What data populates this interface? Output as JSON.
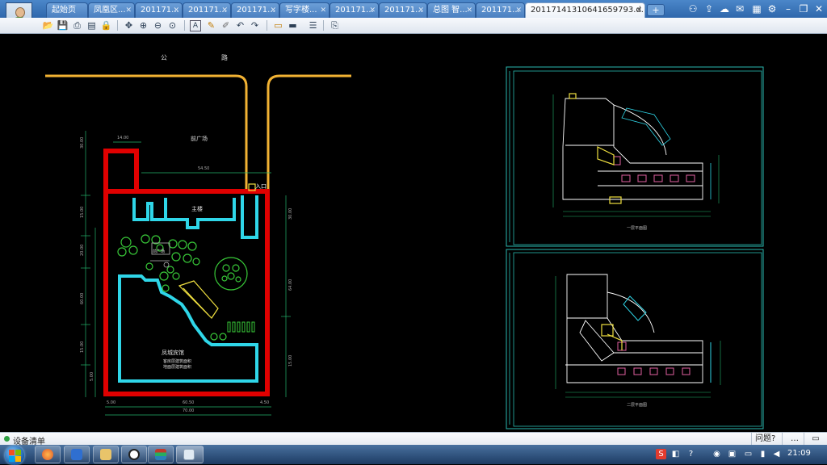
{
  "tabs": [
    {
      "label": "起始页"
    },
    {
      "label": "凤凰区..."
    },
    {
      "label": "201171..."
    },
    {
      "label": "201171..."
    },
    {
      "label": "201171..."
    },
    {
      "label": "写字楼..."
    },
    {
      "label": "201171..."
    },
    {
      "label": "201171..."
    },
    {
      "label": "总图 智..."
    },
    {
      "label": "201171..."
    },
    {
      "label": "20117141310641659793.d..."
    }
  ],
  "new_tab_label": "+",
  "window_icons": [
    "user-group-icon",
    "share-icon",
    "cloud-icon",
    "chat-icon",
    "app-grid-icon",
    "gear-icon",
    "minimize-icon",
    "restore-icon",
    "close-icon"
  ],
  "toolbar_icons": [
    "open-icon",
    "save-icon",
    "print-icon",
    "print-preview-icon",
    "lock-icon",
    "pan-icon",
    "zoom-in-icon",
    "zoom-out-icon",
    "zoom-window-icon",
    "text-icon",
    "pen-icon",
    "highlighter-icon",
    "undo-icon",
    "redo-icon",
    "measure-icon",
    "hide-layer-icon",
    "layers-icon",
    "export-icon"
  ],
  "drawing": {
    "road_label": "公",
    "road_label_2": "路",
    "plaza_label": "前广场",
    "entrance_label": "入口",
    "main_building_label": "主楼",
    "court_label": "前广场",
    "hotel_label": "凤城宾馆",
    "note_1": "客房层建筑面积",
    "note_2": "地面层建筑面积",
    "dim_top_1": "14.00",
    "dim_top_2": "54.50",
    "dim_bottom_1": "5.00",
    "dim_bottom_2": "60.50",
    "dim_bottom_3": "4.50",
    "dim_bottom_total": "70.00",
    "dim_left_1": "30.00",
    "dim_left_2": "15.00",
    "dim_left_3": "20.00",
    "dim_left_4": "60.00",
    "dim_left_5": "15.00",
    "dim_left_6": "5.00",
    "dim_right_1": "30.00",
    "dim_right_2": "64.00",
    "dim_right_3": "15.00",
    "plan_1_title": "一层平面图",
    "plan_2_title": "二层平面图"
  },
  "status": {
    "left_label": "设备清单",
    "right_items": [
      "问题?",
      "…"
    ]
  },
  "taskbar": {
    "clock": "21:09"
  },
  "colors": {
    "site_boundary": "#e00000",
    "building_outline": "#2fd6e8",
    "road": "#f2b233",
    "trees": "#38c838",
    "frame": "#2ab8b0"
  }
}
